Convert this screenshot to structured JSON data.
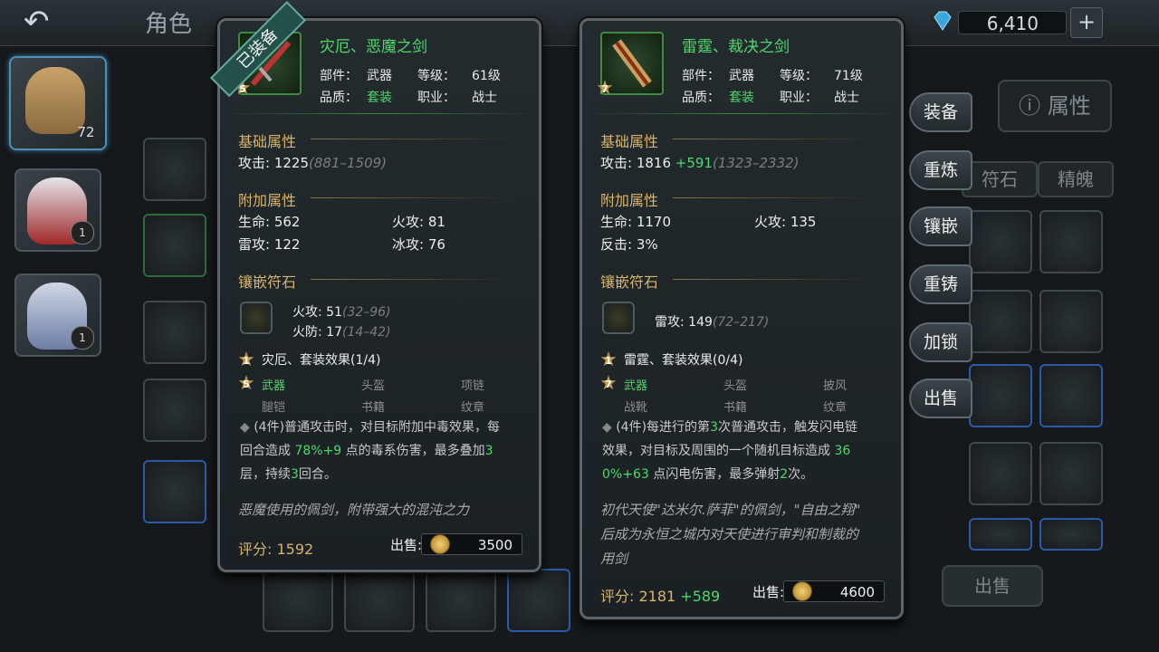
{
  "topbar": {
    "back_icon": "back-arrow-icon",
    "tab_label": "角色",
    "currency_value": "6,410",
    "add_icon": "plus-icon",
    "gem_icon": "diamond-icon"
  },
  "characters": [
    {
      "level": "72",
      "selected": true
    },
    {
      "level": "1",
      "selected": false
    },
    {
      "level": "1",
      "selected": false
    }
  ],
  "side_menu": [
    "装备",
    "重炼",
    "镶嵌",
    "重铸",
    "加锁",
    "出售"
  ],
  "attr_tab": {
    "label": "属性",
    "icon": "info-icon"
  },
  "sub_tabs": [
    "符石",
    "精魄"
  ],
  "bottom_sell": "出售",
  "left_panel": {
    "badge": "已装备",
    "name": "灾厄、恶魔之剑",
    "star": "5",
    "part_label": "部件：",
    "part": "武器",
    "level_label": "等级：",
    "level": "61级",
    "quality_label": "品质：",
    "quality": "套装",
    "job_label": "职业：",
    "job": "战士",
    "base_title": "基础属性",
    "attack_label": "攻击: ",
    "attack": "1225",
    "attack_range": "(881–1509)",
    "extra_title": "附加属性",
    "extra": [
      "生命: 562",
      "火攻: 81",
      "雷攻: 122",
      "冰攻: 76"
    ],
    "rune_title": "镶嵌符石",
    "rune_lines": [
      {
        "text": "火攻: 51",
        "range": "(32–96)"
      },
      {
        "text": "火防: 17",
        "range": "(14–42)"
      }
    ],
    "set_num": "1",
    "set_title": "灾厄、套装效果(1/4)",
    "set_pieces_star": "5",
    "set_pieces": [
      "武器",
      "头盔",
      "项链",
      "腿铠",
      "书籍",
      "纹章"
    ],
    "set_desc_1": "(4件)普通攻击时，对目标附加中毒效果，每",
    "set_desc_2a": "回合造成 ",
    "set_desc_2b": "78%+9",
    "set_desc_2c": " 点的毒系伤害，最多叠加",
    "set_desc_2d": "3",
    "set_desc_3a": "层，持续",
    "set_desc_3b": "3",
    "set_desc_3c": "回合。",
    "lore": "恶魔使用的佩剑，附带强大的混沌之力",
    "score_label": "评分: ",
    "score": "1592",
    "sell_label": "出售:",
    "sell_price": "3500"
  },
  "right_panel": {
    "name": "雷霆、裁决之剑",
    "star": "7",
    "part_label": "部件：",
    "part": "武器",
    "level_label": "等级：",
    "level": "71级",
    "quality_label": "品质：",
    "quality": "套装",
    "job_label": "职业：",
    "job": "战士",
    "base_title": "基础属性",
    "attack_label": "攻击: ",
    "attack": "1816 ",
    "attack_diff": "+591",
    "attack_range": "(1323–2332)",
    "extra_title": "附加属性",
    "extra": [
      "生命: 1170",
      "火攻: 135",
      "反击: 3%"
    ],
    "rune_title": "镶嵌符石",
    "rune_lines": [
      {
        "text": "雷攻: 149",
        "range": "(72–217)"
      }
    ],
    "set_num": "1",
    "set_title": "雷霆、套装效果(0/4)",
    "set_pieces_star": "7",
    "set_pieces": [
      "武器",
      "头盔",
      "披风",
      "战靴",
      "书籍",
      "纹章"
    ],
    "set_desc_1a": "(4件)每进行的第",
    "set_desc_1b": "3",
    "set_desc_1c": "次普通攻击，触发闪电链",
    "set_desc_2a": "效果，对目标及周围的一个随机目标造成 ",
    "set_desc_2b": "36",
    "set_desc_3a": "0%+63",
    "set_desc_3b": " 点闪电伤害，最多弹射",
    "set_desc_3c": "2",
    "set_desc_3d": "次。",
    "lore_1": "初代天使\"达米尔.萨菲\"的佩剑，\"自由之翔\"",
    "lore_2": "后成为永恒之城内对天使进行审判和制裁的",
    "lore_3": "用剑",
    "score_label": "评分: ",
    "score": "2181",
    "score_diff": " +589",
    "sell_label": "出售:",
    "sell_price": "4600"
  }
}
